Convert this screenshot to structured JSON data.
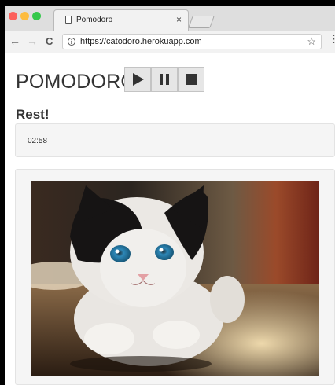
{
  "browser": {
    "tab_title": "Pomodoro",
    "tab_close": "×",
    "url": "https://catodoro.herokuapp.com",
    "back_glyph": "←",
    "forward_glyph": "→",
    "reload_glyph": "C",
    "info_glyph": "i",
    "star_glyph": "☆",
    "menu_glyph": "⋮"
  },
  "app": {
    "title": "POMODORO",
    "controls": [
      "play-icon",
      "pause-icon",
      "stop-icon"
    ],
    "status": "Rest!",
    "timer": "02:58"
  },
  "image": {
    "subject": "kitten-photo"
  },
  "colors": {
    "close_light": "#fc605c",
    "min_light": "#fdbc40",
    "max_light": "#34c84a",
    "panel_bg": "#f5f5f5",
    "button_bg": "#e6e6e6",
    "icon_dark": "#333333"
  }
}
